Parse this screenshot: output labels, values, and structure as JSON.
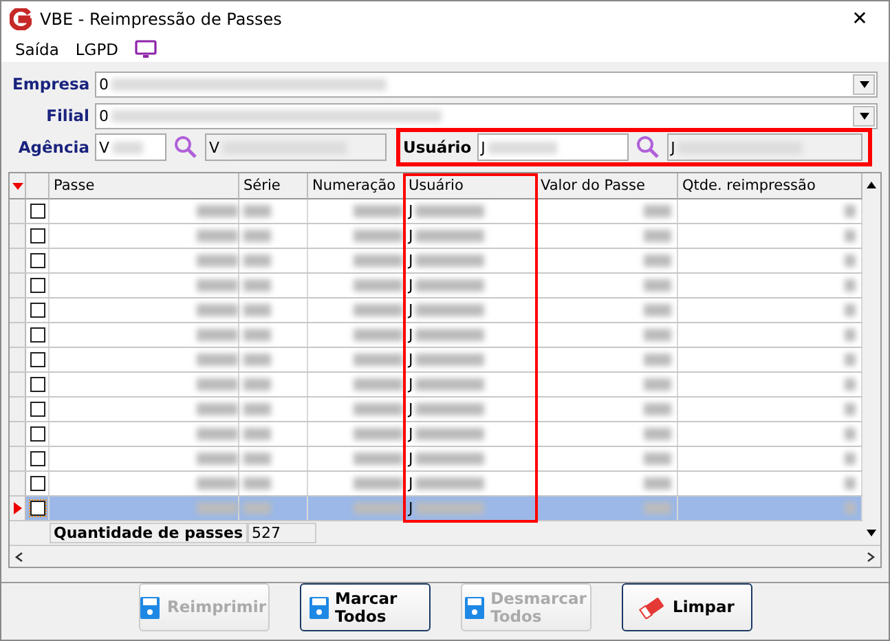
{
  "window": {
    "title": "VBE - Reimpressão de Passes",
    "close": "✕"
  },
  "menu": [
    {
      "label": "Saída",
      "kind": "text"
    },
    {
      "label": "LGPD",
      "kind": "text"
    },
    {
      "kind": "monitor"
    }
  ],
  "filters": {
    "empresa": {
      "label": "Empresa",
      "value": "0"
    },
    "filial": {
      "label": "Filial",
      "value": "0"
    },
    "agencia": {
      "label": "Agência",
      "code": "V",
      "name": "V"
    },
    "usuario": {
      "label": "Usuário",
      "code": "J",
      "name": "J",
      "highlighted": true
    }
  },
  "table": {
    "columns": [
      {
        "label": "Passe",
        "highlighted": false
      },
      {
        "label": "Série",
        "highlighted": false
      },
      {
        "label": "Numeração",
        "highlighted": false
      },
      {
        "label": "Usuário",
        "highlighted": true
      },
      {
        "label": "Valor do Passe",
        "highlighted": false
      },
      {
        "label": "Qtde. reimpressão",
        "highlighted": false
      }
    ],
    "rows": [
      {
        "usuario": "J",
        "checked": false,
        "selected": false
      },
      {
        "usuario": "J",
        "checked": false,
        "selected": false
      },
      {
        "usuario": "J",
        "checked": false,
        "selected": false
      },
      {
        "usuario": "J",
        "checked": false,
        "selected": false
      },
      {
        "usuario": "J",
        "checked": false,
        "selected": false
      },
      {
        "usuario": "J",
        "checked": false,
        "selected": false
      },
      {
        "usuario": "J",
        "checked": false,
        "selected": false
      },
      {
        "usuario": "J",
        "checked": false,
        "selected": false
      },
      {
        "usuario": "J",
        "checked": false,
        "selected": false
      },
      {
        "usuario": "J",
        "checked": false,
        "selected": false
      },
      {
        "usuario": "J",
        "checked": false,
        "selected": false
      },
      {
        "usuario": "J",
        "checked": false,
        "selected": false
      },
      {
        "usuario": "J",
        "checked": false,
        "selected": true
      }
    ],
    "footer": {
      "label": "Quantidade de passes",
      "value": "527"
    }
  },
  "buttons": [
    {
      "label": "Reimprimir",
      "kind": "save",
      "disabled": true
    },
    {
      "label": "Marcar Todos",
      "kind": "save",
      "disabled": false
    },
    {
      "label": "Desmarcar Todos",
      "kind": "save",
      "disabled": true
    },
    {
      "label": "Limpar",
      "kind": "eraser",
      "disabled": false
    }
  ]
}
